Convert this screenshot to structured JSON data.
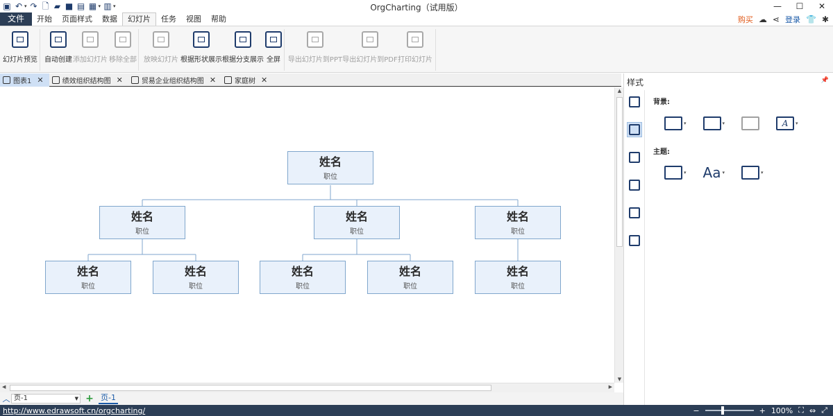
{
  "app": {
    "title": "OrgCharting（试用版）",
    "quick_access": [
      "app-icon",
      "undo-icon",
      "redo-icon",
      "new-icon",
      "open-icon",
      "save-icon",
      "print-icon",
      "export-icon",
      "template-icon",
      "customize-icon"
    ]
  },
  "window_controls": {
    "minimize": "—",
    "maximize": "☐",
    "close": "✕"
  },
  "menu": {
    "file": "文件",
    "tabs": [
      "开始",
      "页面样式",
      "数据",
      "幻灯片",
      "任务",
      "视图",
      "帮助"
    ],
    "active_tab": "幻灯片",
    "buy": "购买",
    "login": "登录"
  },
  "ribbon": {
    "buttons": [
      {
        "label": "幻灯片预览",
        "enabled": true
      },
      {
        "label": "自动创建",
        "enabled": true
      },
      {
        "label": "添加幻灯片",
        "enabled": false
      },
      {
        "label": "移除全部",
        "enabled": false
      },
      {
        "label": "放映幻灯片",
        "enabled": false
      },
      {
        "label": "根据形状展示",
        "enabled": true
      },
      {
        "label": "根据分支展示",
        "enabled": true
      },
      {
        "label": "全屏",
        "enabled": true
      },
      {
        "label": "导出幻灯片到PPT",
        "enabled": false
      },
      {
        "label": "导出幻灯片到PDF",
        "enabled": false
      },
      {
        "label": "打印幻灯片",
        "enabled": false
      }
    ]
  },
  "doc_tabs": [
    {
      "label": "图表1",
      "active": true
    },
    {
      "label": "绩效组织结构图",
      "active": false
    },
    {
      "label": "贸易企业组织结构图",
      "active": false
    },
    {
      "label": "家庭树",
      "active": false
    }
  ],
  "org_chart": {
    "root": {
      "name": "姓名",
      "position": "职位"
    },
    "level1": [
      {
        "name": "姓名",
        "position": "职位"
      },
      {
        "name": "姓名",
        "position": "职位"
      },
      {
        "name": "姓名",
        "position": "职位"
      }
    ],
    "level2": [
      {
        "name": "姓名",
        "position": "职位"
      },
      {
        "name": "姓名",
        "position": "职位"
      },
      {
        "name": "姓名",
        "position": "职位"
      },
      {
        "name": "姓名",
        "position": "职位"
      },
      {
        "name": "姓名",
        "position": "职位"
      }
    ]
  },
  "page_bar": {
    "selector_value": "页-1",
    "add_symbol": "+",
    "current_page_tab": "页-1"
  },
  "side_panel": {
    "title": "样式",
    "background_label": "背景:",
    "theme_label": "主题:",
    "rail_icons": [
      "contact-card-icon",
      "paint-brush-icon",
      "list-icon",
      "calendar-icon",
      "tree-icon",
      "search-list-icon"
    ],
    "background_tools": [
      "fill-color-icon",
      "insert-image-icon",
      "remove-image-icon",
      "text-style-icon"
    ],
    "theme_tools": [
      "layout-theme-icon",
      "font-theme-icon",
      "color-theme-icon"
    ],
    "font_glyph": "Aa",
    "text_glyph": "A"
  },
  "status_bar": {
    "url": "http://www.edrawsoft.cn/orgcharting/",
    "zoom_minus": "−",
    "zoom_plus": "+",
    "zoom_level": "100%",
    "zoom_fraction": 0.35
  }
}
